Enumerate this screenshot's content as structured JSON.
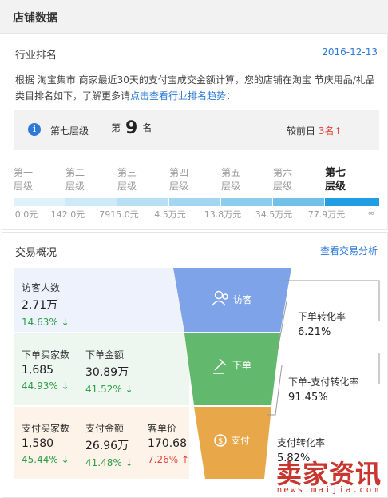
{
  "header": {
    "title": "店铺数据"
  },
  "industry": {
    "title": "行业排名",
    "date": "2016-12-13",
    "desc_text": "根据 淘宝集市 商家最近30天的支付宝成交金额计算，您的店铺在淘宝 节庆用品/礼品类目排名如下，了解更多请",
    "desc_link": "点击查看行业排名趋势",
    "desc_end": "：",
    "level_label": "第七层级",
    "rank_prefix": "第",
    "rank_value": "9",
    "rank_suffix": "名",
    "compare_label": "较前日",
    "compare_value": "3名",
    "compare_arrow": "↑"
  },
  "tiers": [
    {
      "line1": "第一",
      "line2": "层级"
    },
    {
      "line1": "第二",
      "line2": "层级"
    },
    {
      "line1": "第三",
      "line2": "层级"
    },
    {
      "line1": "第四",
      "line2": "层级"
    },
    {
      "line1": "第五",
      "line2": "层级"
    },
    {
      "line1": "第六",
      "line2": "层级"
    },
    {
      "line1": "第七",
      "line2": "层级"
    }
  ],
  "tier_values": [
    "0.0元",
    "142.0元",
    "7915.0元",
    "4.5万元",
    "13.8万元",
    "34.5万元",
    "77.9万元",
    "∞"
  ],
  "bar_colors": [
    "#dff1fb",
    "#cdeaf8",
    "#b8e0f5",
    "#a3d6f2",
    "#8ccced",
    "#72c0e8",
    "#1f9ee3"
  ],
  "trade": {
    "title": "交易概况",
    "link": "查看交易分析",
    "visitors_label": "访客人数",
    "visitors_value": "2.71万",
    "visitors_change": "14.63%",
    "order_buyers_label": "下单买家数",
    "order_buyers_value": "1,685",
    "order_buyers_change": "44.93%",
    "order_amount_label": "下单金额",
    "order_amount_value": "30.89万",
    "order_amount_change": "41.52%",
    "pay_buyers_label": "支付买家数",
    "pay_buyers_value": "1,580",
    "pay_buyers_change": "45.44%",
    "pay_amount_label": "支付金额",
    "pay_amount_value": "26.96万",
    "pay_amount_change": "41.48%",
    "unit_price_label": "客单价",
    "unit_price_value": "170.68",
    "unit_price_change": "7.26%",
    "down_arrow": "↓",
    "up_arrow": "↑",
    "funnel_visit": "访客",
    "funnel_order": "下单",
    "funnel_pay": "支付",
    "conv_order_label": "下单转化率",
    "conv_order_value": "6.21%",
    "conv_order_pay_label": "下单-支付转化率",
    "conv_order_pay_value": "91.45%",
    "conv_pay_label": "支付转化率",
    "conv_pay_value": "5.82%",
    "colors": {
      "visit": "#7ea3e8",
      "order": "#62b86c",
      "pay": "#e8a84a"
    }
  },
  "watermark": {
    "main": "卖家资讯",
    "sub": "news.maijia.com"
  }
}
